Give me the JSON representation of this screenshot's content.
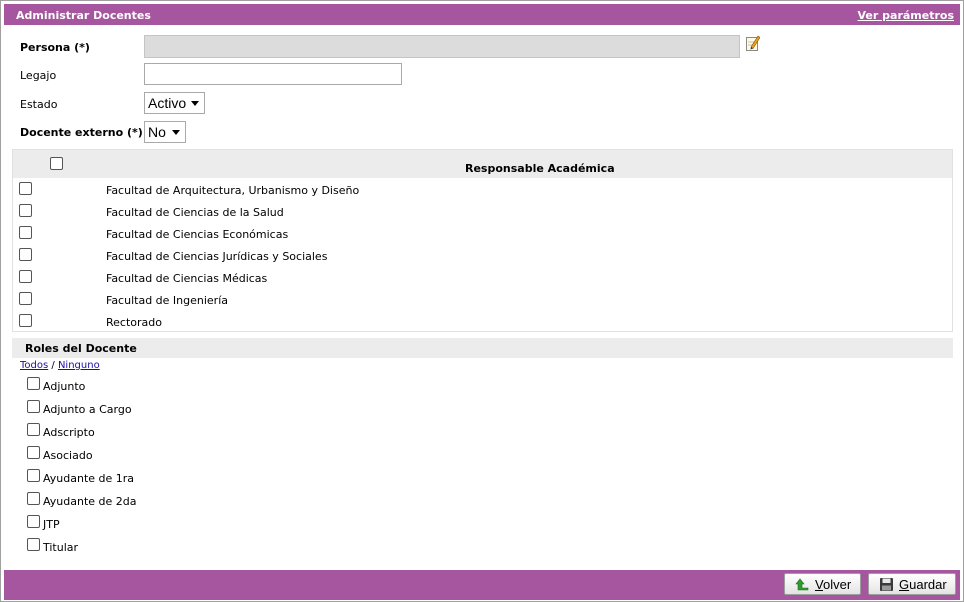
{
  "header": {
    "title": "Administrar Docentes",
    "params_link": "Ver parámetros"
  },
  "form": {
    "persona_label": "Persona (*)",
    "persona_value": "",
    "legajo_label": "Legajo",
    "legajo_value": "",
    "estado_label": "Estado",
    "estado_selected": "Activo",
    "externo_label": "Docente externo (*)",
    "externo_selected": "No"
  },
  "responsables": {
    "header": "Responsable Académica",
    "items": [
      {
        "label": "Facultad de Arquitectura, Urbanismo y Diseño",
        "checked": false
      },
      {
        "label": "Facultad de Ciencias de la Salud",
        "checked": false
      },
      {
        "label": "Facultad de Ciencias Económicas",
        "checked": false
      },
      {
        "label": "Facultad de Ciencias Jurídicas y Sociales",
        "checked": false
      },
      {
        "label": "Facultad de Ciencias Médicas",
        "checked": false
      },
      {
        "label": "Facultad de Ingeniería",
        "checked": false
      },
      {
        "label": "Rectorado",
        "checked": false
      }
    ]
  },
  "roles": {
    "header": "Roles del Docente",
    "all_link": "Todos",
    "separator": "/",
    "none_link": "Ninguno",
    "items": [
      {
        "label": "Adjunto",
        "checked": false
      },
      {
        "label": "Adjunto a Cargo",
        "checked": false
      },
      {
        "label": "Adscripto",
        "checked": false
      },
      {
        "label": "Asociado",
        "checked": false
      },
      {
        "label": "Ayudante de 1ra",
        "checked": false
      },
      {
        "label": "Ayudante de 2da",
        "checked": false
      },
      {
        "label": "JTP",
        "checked": false
      },
      {
        "label": "Titular",
        "checked": false
      }
    ]
  },
  "footer": {
    "back_hotkey": "V",
    "back_rest": "olver",
    "save_hotkey": "G",
    "save_rest": "uardar"
  },
  "colors": {
    "accent": "#a5569e",
    "panel": "#ececec"
  }
}
